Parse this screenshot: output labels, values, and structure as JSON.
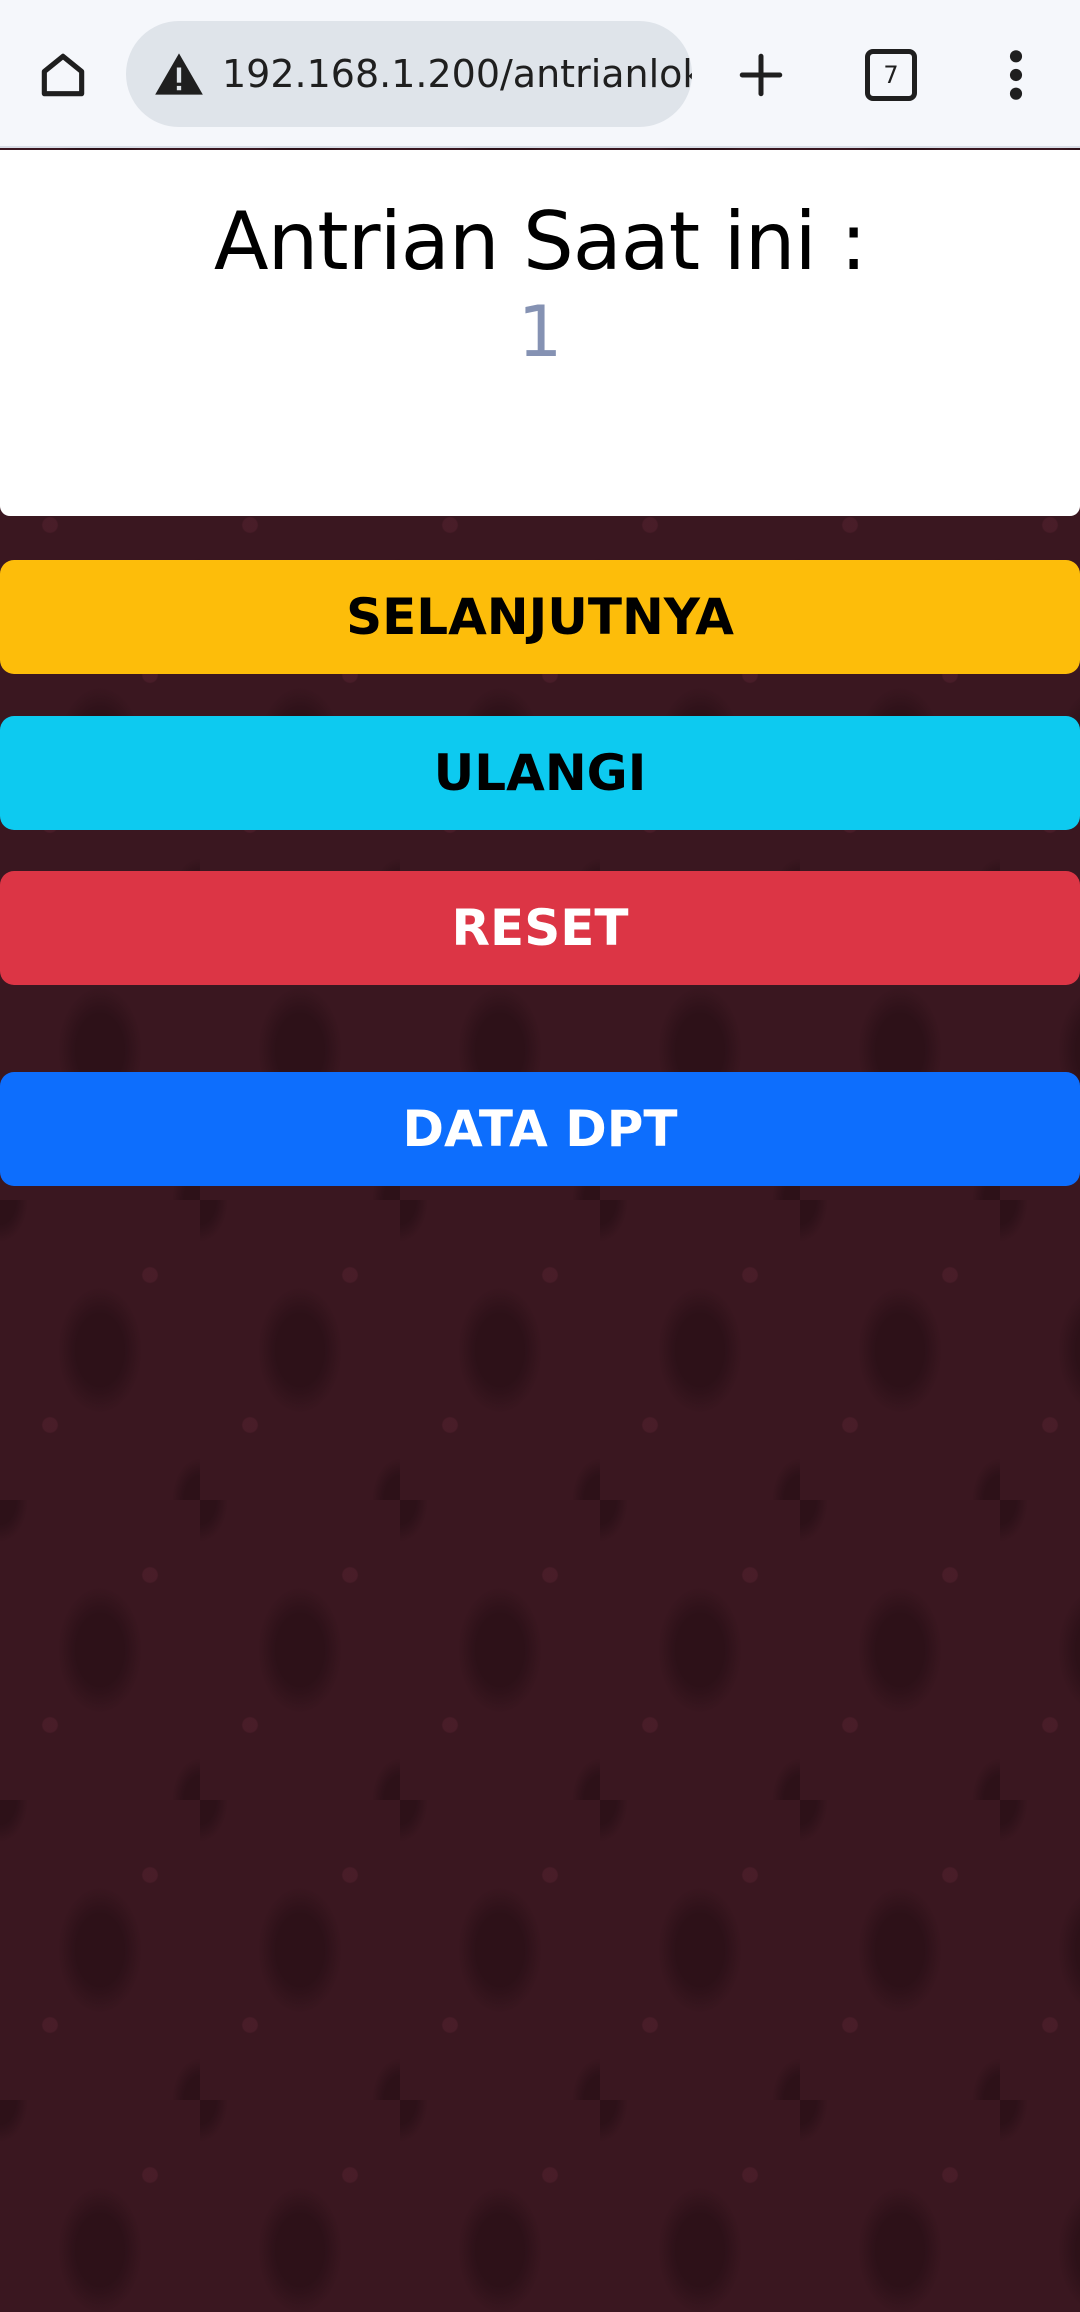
{
  "browser": {
    "url": "192.168.1.200/antrianlok",
    "tab_count": "7",
    "icons": {
      "home": "home-icon",
      "warning": "warning-icon",
      "new_tab": "plus-icon",
      "tabs": "tab-switcher-icon",
      "menu": "more-vert-icon"
    }
  },
  "queue": {
    "title": "Antrian Saat ini :",
    "current_number": "1"
  },
  "buttons": {
    "next": "SELANJUTNYA",
    "repeat": "ULANGI",
    "reset": "RESET",
    "data": "DATA DPT"
  },
  "colors": {
    "next": "#fdbd0a",
    "repeat": "#0dcaf0",
    "reset": "#dc3545",
    "data": "#0d6efd",
    "number_text": "#8592b3",
    "background": "#3a1720"
  }
}
